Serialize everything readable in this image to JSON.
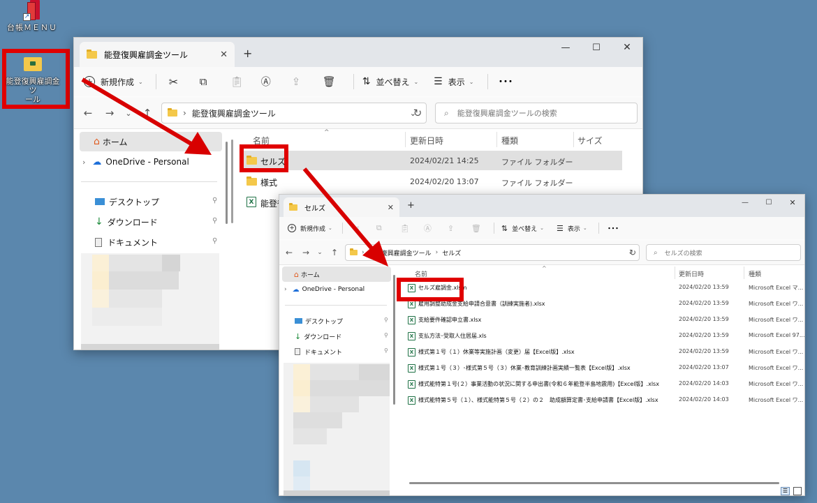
{
  "desktop": {
    "menu_icon_label": "台帳ＭＥＮＵ",
    "tool_icon_label": "能登復興雇調金ツ\nール"
  },
  "win1": {
    "tab_title": "能登復興雇調金ツール",
    "toolbar": {
      "new": "新規作成",
      "sort": "並べ替え",
      "view": "表示",
      "more": "･･･"
    },
    "address": {
      "crumb": "能登復興雇調金ツール"
    },
    "search_placeholder": "能登復興雇調金ツールの検索",
    "sidebar": {
      "home": "ホーム",
      "onedrive": "OneDrive - Personal",
      "desktop": "デスクトップ",
      "download": "ダウンロード",
      "documents": "ドキュメント"
    },
    "columns": {
      "name": "名前",
      "date": "更新日時",
      "type": "種類",
      "size": "サイズ"
    },
    "files": [
      {
        "name": "セルズ",
        "date": "2024/02/21 14:25",
        "type": "ファイル フォルダー",
        "icon": "folder-icon"
      },
      {
        "name": "様式",
        "date": "2024/02/20 13:07",
        "type": "ファイル フォルダー",
        "icon": "folder-icon"
      },
      {
        "name": "能登復",
        "date": "",
        "type": "",
        "icon": "excel-icon"
      }
    ]
  },
  "win2": {
    "tab_title": "セルズ",
    "toolbar": {
      "new": "新規作成",
      "sort": "並べ替え",
      "view": "表示",
      "more": "･･･"
    },
    "address": {
      "crumb1": "能登復興雇調金ツール",
      "crumb2": "セルズ"
    },
    "search_placeholder": "セルズの検索",
    "sidebar": {
      "home": "ホーム",
      "onedrive": "OneDrive - Personal",
      "desktop": "デスクトップ",
      "download": "ダウンロード",
      "documents": "ドキュメント"
    },
    "columns": {
      "name": "名前",
      "date": "更新日時",
      "type": "種類"
    },
    "files": [
      {
        "name": "セルズ雇調金.xlsm",
        "date": "2024/02/20 13:59",
        "type": "Microsoft Excel マ..."
      },
      {
        "name": "雇用調整助成金支給申請合意書（訓練実施者).xlsx",
        "date": "2024/02/20 13:59",
        "type": "Microsoft Excel ワ..."
      },
      {
        "name": "支給要件確認申立書.xlsx",
        "date": "2024/02/20 13:59",
        "type": "Microsoft Excel ワ..."
      },
      {
        "name": "支払方法･受取人住居届.xls",
        "date": "2024/02/20 13:59",
        "type": "Microsoft Excel 97..."
      },
      {
        "name": "様式第１号（１）休業等実施計画（変更）届【Excel版】.xlsx",
        "date": "2024/02/20 13:59",
        "type": "Microsoft Excel ワ..."
      },
      {
        "name": "様式第１号（３）･様式第５号（３）休業･教育訓練計画実績一覧表【Excel版】.xlsx",
        "date": "2024/02/20 13:07",
        "type": "Microsoft Excel ワ..."
      },
      {
        "name": "様式能特第１号(２）事業活動の状況に関する申出書(令和６年能登半島地震用)【Excel版】.xlsx",
        "date": "2024/02/20 14:03",
        "type": "Microsoft Excel ワ..."
      },
      {
        "name": "様式能特第５号（１）、様式能特第５号（２）の２　助成額算定書･支給申請書【Excel版】.xlsx",
        "date": "2024/02/20 14:03",
        "type": "Microsoft Excel ワ..."
      }
    ]
  },
  "colors": {
    "highlight": "#e00000",
    "desktop": "#5b87ad",
    "folder": "#f4c84a",
    "excel": "#1e7145"
  }
}
